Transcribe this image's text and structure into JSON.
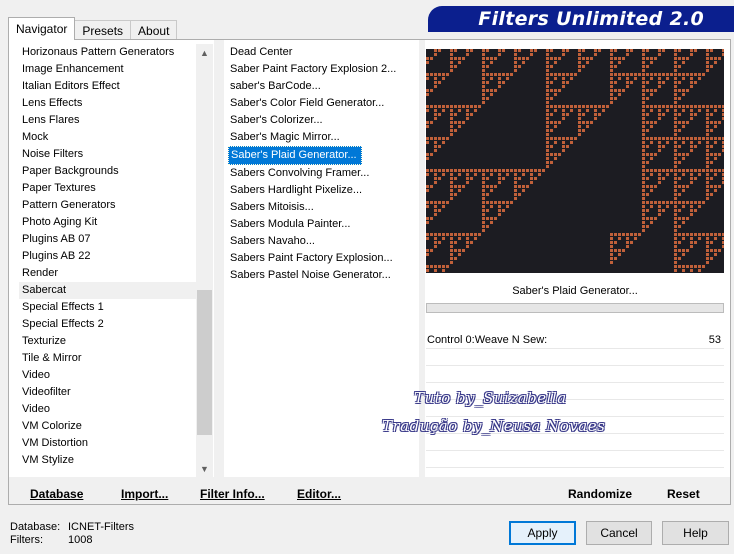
{
  "tabs": [
    {
      "label": "Navigator",
      "active": true
    },
    {
      "label": "Presets",
      "active": false
    },
    {
      "label": "About",
      "active": false
    }
  ],
  "banner": {
    "title": "Filters Unlimited 2.0"
  },
  "categories": [
    "Horizonaus Pattern Generators",
    "Image Enhancement",
    "Italian Editors Effect",
    "Lens Effects",
    "Lens Flares",
    "Mock",
    "Noise Filters",
    "Paper Backgrounds",
    "Paper Textures",
    "Pattern Generators",
    "Photo Aging Kit",
    "Plugins AB 07",
    "Plugins AB 22",
    "Render",
    "Sabercat",
    "Special Effects 1",
    "Special Effects 2",
    "Texturize",
    "Tile & Mirror",
    "Video",
    "Videofilter",
    "Video",
    "VM Colorize",
    "VM Distortion",
    "VM Stylize"
  ],
  "selected_category": "Sabercat",
  "filters": [
    "Dead Center",
    "Saber Paint Factory Explosion 2...",
    "saber's BarCode...",
    "Saber's Color Field Generator...",
    "Saber's Colorizer...",
    "Saber's Magic Mirror...",
    "Saber's Plaid Generator...",
    "Sabers Convolving Framer...",
    "Sabers Hardlight Pixelize...",
    "Sabers Mitoisis...",
    "Sabers Modula Painter...",
    "Sabers Navaho...",
    "Sabers Paint Factory Explosion...",
    "Sabers Pastel Noise Generator..."
  ],
  "selected_filter": "Saber's Plaid Generator...",
  "preview": {
    "filter_name": "Saber's Plaid Generator...",
    "background": "#1c1c22",
    "pattern_color": "#c0603a"
  },
  "controls": [
    {
      "label": "Control 0:Weave N Sew:",
      "value": "53"
    }
  ],
  "buttons_left": {
    "database": "Database",
    "import": "Import...",
    "filter_info": "Filter Info...",
    "editor": "Editor..."
  },
  "buttons_right": {
    "randomize": "Randomize",
    "reset": "Reset"
  },
  "watermark": {
    "line1": "Tuto by_Suizabella",
    "line2": "Tradução by_Neusa Novaes"
  },
  "status": {
    "database_label": "Database:",
    "database_value": "ICNET-Filters",
    "filters_label": "Filters:",
    "filters_value": "1008"
  },
  "dialog_buttons": {
    "apply": "Apply",
    "cancel": "Cancel",
    "help": "Help"
  },
  "colors": {
    "accent": "#0078d7",
    "banner": "#0b1f8e"
  }
}
